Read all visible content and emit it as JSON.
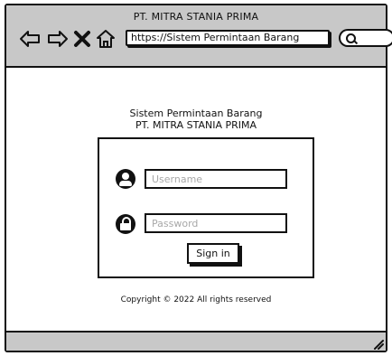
{
  "window": {
    "title": "PT. MITRA STANIA PRIMA",
    "url": "https://Sistem Permintaan Barang"
  },
  "navigation": {
    "back_icon": "arrow-left-icon",
    "forward_icon": "arrow-right-icon",
    "close_icon": "close-icon",
    "home_icon": "home-icon",
    "search_icon": "search-icon"
  },
  "login": {
    "heading_line1": "Sistem Permintaan Barang",
    "heading_line2": "PT. MITRA STANIA PRIMA",
    "username_placeholder": "Username",
    "password_placeholder": "Password",
    "sign_in_label": "Sign in",
    "username_icon": "user-icon",
    "password_icon": "lock-icon"
  },
  "footer": {
    "copyright": "Copyright © 2022 All rights reserved"
  }
}
